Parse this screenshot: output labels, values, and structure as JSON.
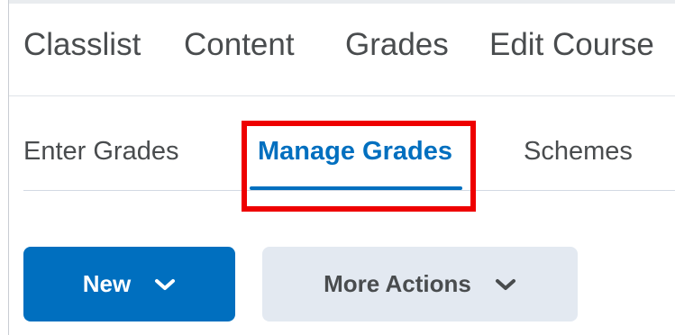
{
  "navbar": {
    "items": [
      {
        "label": "Classlist"
      },
      {
        "label": "Content"
      },
      {
        "label": "Grades"
      },
      {
        "label": "Edit Course"
      }
    ]
  },
  "tabs": {
    "items": [
      {
        "label": "Enter Grades"
      },
      {
        "label": "Manage Grades",
        "active": true
      },
      {
        "label": "Schemes"
      }
    ]
  },
  "toolbar": {
    "new_label": "New",
    "more_actions_label": "More Actions"
  },
  "colors": {
    "accent": "#006fbf",
    "highlight": "#ee0000",
    "secondary_button": "#e3e9f1",
    "text": "#494c4e"
  },
  "icons": {
    "new_dropdown": "chevron-down-icon",
    "more_actions_dropdown": "chevron-down-icon"
  }
}
